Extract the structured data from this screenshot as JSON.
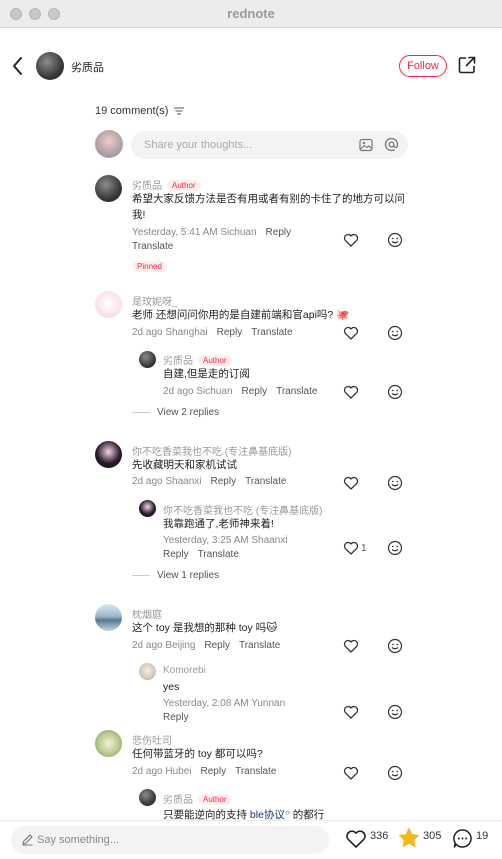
{
  "app": {
    "title": "rednote"
  },
  "header": {
    "author_name": "劣质品",
    "follow_label": "Follow"
  },
  "comments_header": {
    "count_text": "19 comment(s)"
  },
  "composer": {
    "placeholder": "Share your thoughts..."
  },
  "comments": [
    {
      "name": "劣质品",
      "badge": "Author",
      "text": "希望大家反馈方法是否有用或者有别的卡住了的地方可以问我!",
      "time": "Yesterday, 5:41 AM Sichuan",
      "reply": "Reply",
      "translate": "Translate",
      "pinned": "Pinned"
    },
    {
      "name": "是玟妮呀_",
      "text": "老师 还想问问你用的是自建前端和官api吗?",
      "time": "2d ago Shanghai",
      "reply": "Reply",
      "translate": "Translate",
      "replies": [
        {
          "name": "劣质品",
          "badge": "Author",
          "text": "自建,但是走的订阅",
          "time": "2d ago Sichuan",
          "reply": "Reply",
          "translate": "Translate"
        }
      ],
      "view_more": "View 2 replies"
    },
    {
      "name": "你不吃香菜我也不吃 (专注鼻基底版)",
      "text": "先收藏明天和家机试试",
      "time": "2d ago Shaanxi",
      "reply": "Reply",
      "translate": "Translate",
      "replies": [
        {
          "name": "你不吃香菜我也不吃 (专注鼻基底版)",
          "text": "我靠跑通了,老师神来着!",
          "time": "Yesterday, 3:25 AM Shaanxi",
          "reply": "Reply",
          "translate": "Translate",
          "likes": "1"
        }
      ],
      "view_more": "View 1 replies"
    },
    {
      "name": "枕烟庭",
      "text": "这个 toy 是我想的那种 toy 吗",
      "time": "2d ago Beijing",
      "reply": "Reply",
      "translate": "Translate",
      "replies": [
        {
          "name": "Komorebi",
          "text": "yes",
          "time": "Yesterday, 2:08 AM Yunnan",
          "reply": "Reply"
        }
      ]
    },
    {
      "name": "悲伤吐司",
      "text": "任何带蓝牙的 toy 都可以吗?",
      "time": "2d ago Hubei",
      "reply": "Reply",
      "translate": "Translate",
      "replies": [
        {
          "name": "劣质品",
          "badge": "Author",
          "text_prefix": "只要能逆向的支持 ",
          "link": "ble协议",
          "text_suffix": " 的都行"
        }
      ]
    }
  ],
  "bottom_bar": {
    "placeholder": "Say something...",
    "likes": "336",
    "favorites": "305",
    "comments": "19"
  },
  "colors": {
    "accent": "#ff2442",
    "star": "#f5b81b",
    "link": "#13386c"
  }
}
